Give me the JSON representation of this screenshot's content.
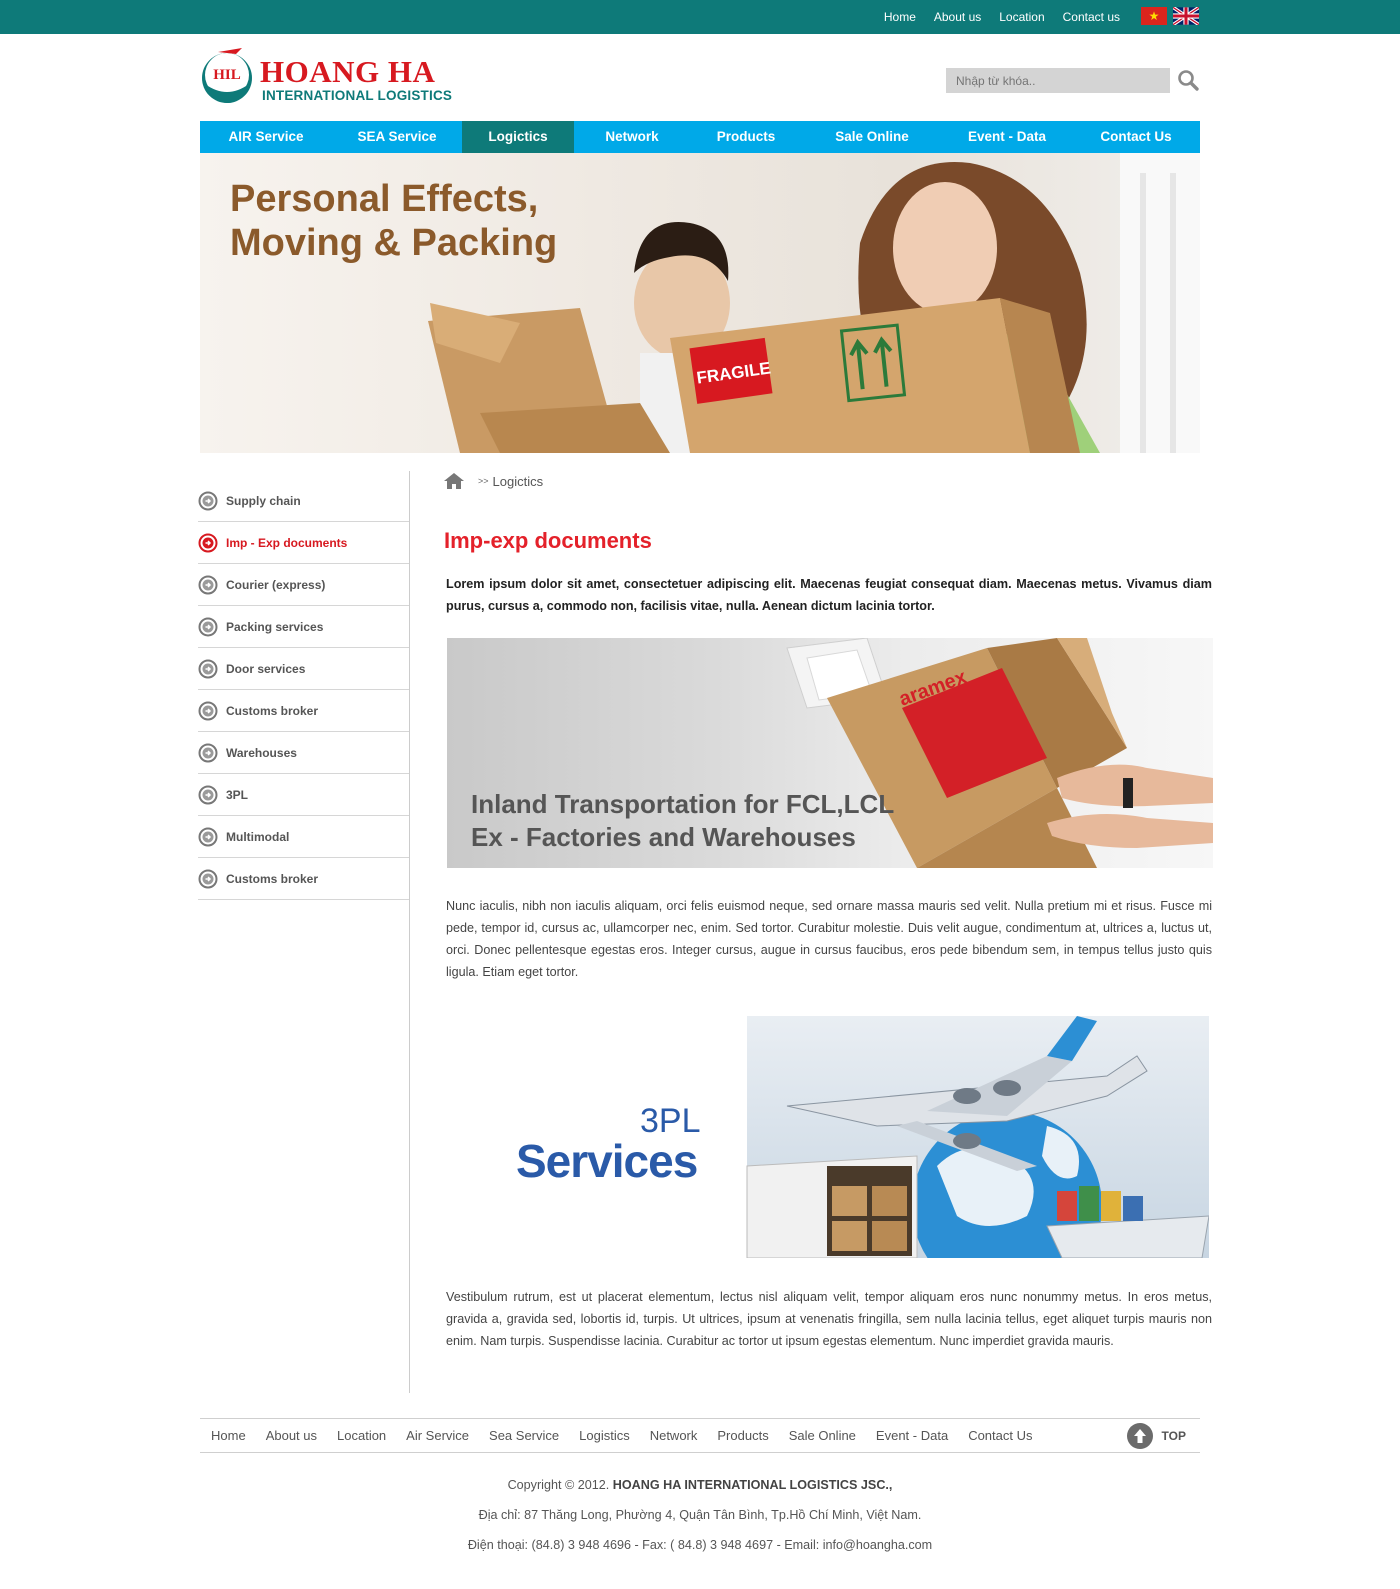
{
  "topbar": {
    "links": [
      "Home",
      "About us",
      "Location",
      "Contact us"
    ],
    "flags": [
      "vietnam-flag-icon",
      "uk-flag-icon"
    ]
  },
  "header": {
    "logo_mark": "HIL",
    "logo_name": "HOANG HA",
    "logo_sub": "INTERNATIONAL LOGISTICS",
    "search_placeholder": "Nhập từ khóa..",
    "search_icon": "search-icon"
  },
  "mainnav": {
    "items": [
      "AIR Service",
      "SEA Service",
      "Logictics",
      "Network",
      "Products",
      "Sale Online",
      "Event - Data",
      "Contact Us"
    ],
    "active_index": 2
  },
  "hero": {
    "title_line1": "Personal Effects,",
    "title_line2": "Moving & Packing",
    "fragile_label": "FRAGILE"
  },
  "sidebar": {
    "items": [
      "Supply chain",
      "Imp - Exp documents",
      "Courier (express)",
      "Packing services",
      "Door services",
      "Customs broker",
      "Warehouses",
      "3PL",
      "Multimodal",
      "Customs broker"
    ],
    "active_index": 1
  },
  "breadcrumb": {
    "separator": ">>",
    "current": "Logictics"
  },
  "content": {
    "title": "Imp-exp documents",
    "intro": "Lorem ipsum dolor sit amet, consectetuer adipiscing elit. Maecenas feugiat consequat diam. Maecenas metus. Vivamus diam purus, cursus a, commodo non, facilisis vitae, nulla. Aenean dictum lacinia tortor.",
    "image1_line1": "Inland Transportation for FCL,LCL",
    "image1_line2": "Ex - Factories and Warehouses",
    "image1_brand": "aramex",
    "para1": "Nunc iaculis, nibh non iaculis aliquam, orci felis euismod neque, sed ornare massa mauris sed velit. Nulla pretium mi et risus. Fusce mi pede, tempor id, cursus ac, ullamcorper nec, enim. Sed tortor. Curabitur molestie. Duis velit augue, condimentum at, ultrices a, luctus ut, orci. Donec pellentesque egestas eros. Integer cursus, augue in cursus faucibus, eros pede bibendum sem, in tempus tellus justo quis ligula. Etiam eget tortor.",
    "image2_3pl": "3PL",
    "image2_services": "Services",
    "para2": "Vestibulum rutrum, est ut placerat elementum, lectus nisl aliquam velit, tempor aliquam eros nunc nonummy metus. In eros metus, gravida a, gravida sed, lobortis id, turpis. Ut ultrices, ipsum at venenatis fringilla, sem nulla lacinia tellus, eget aliquet turpis mauris non enim. Nam turpis. Suspendisse lacinia. Curabitur ac tortor ut ipsum egestas elementum. Nunc imperdiet gravida mauris."
  },
  "footer": {
    "links": [
      "Home",
      "About us",
      "Location",
      "Air Service",
      "Sea Service",
      "Logistics",
      "Network",
      "Products",
      "Sale Online",
      "Event - Data",
      "Contact Us"
    ],
    "top_label": "TOP",
    "copyright_prefix": "Copyright © 2012.",
    "company": "HOANG HA INTERNATIONAL LOGISTICS JSC.,",
    "address": "Địa chỉ: 87 Thăng Long, Phường 4, Quận Tân Bình, Tp.Hồ Chí Minh, Việt Nam.",
    "contact": "Điện thoại: (84.8) 3 948 4696 - Fax: ( 84.8) 3 948 4697 - Email: info@hoangha.com"
  },
  "colors": {
    "teal": "#0e7a79",
    "nav_blue": "#00a9e8",
    "accent_red": "#e4212a",
    "hero_brown": "#8b5a2b",
    "services_blue": "#2a5aa8"
  }
}
